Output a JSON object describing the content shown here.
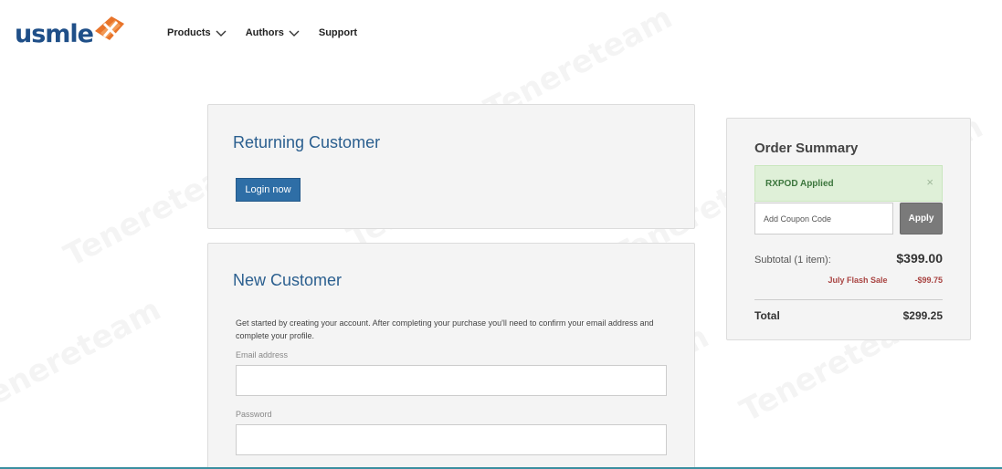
{
  "header": {
    "logo_text": "usmle",
    "nav": [
      {
        "label": "Products",
        "has_dropdown": true
      },
      {
        "label": "Authors",
        "has_dropdown": true
      },
      {
        "label": "Support",
        "has_dropdown": false
      }
    ]
  },
  "returning": {
    "title": "Returning Customer",
    "login_button": "Login now"
  },
  "new_customer": {
    "title": "New Customer",
    "description": "Get started by creating your account. After completing your purchase you'll need to confirm your email address and complete your profile.",
    "email_label": "Email address",
    "email_value": "",
    "password_label": "Password",
    "password_value": ""
  },
  "summary": {
    "title": "Order Summary",
    "coupon_applied": "RXPOD Applied",
    "close_glyph": "×",
    "coupon_placeholder": "Add Coupon Code",
    "apply_button": "Apply",
    "subtotal_label": "Subtotal (1 item):",
    "subtotal_value": "$399.00",
    "discount_label": "July Flash Sale",
    "discount_value": "-$99.75",
    "total_label": "Total",
    "total_value": "$299.25"
  },
  "watermark": "Tenereteam",
  "colors": {
    "brand_blue": "#1f4f88",
    "logo_orange": "#e8742a",
    "primary_button": "#2e6ea6",
    "success_bg": "#dff0d8",
    "discount_red": "#a94442"
  }
}
